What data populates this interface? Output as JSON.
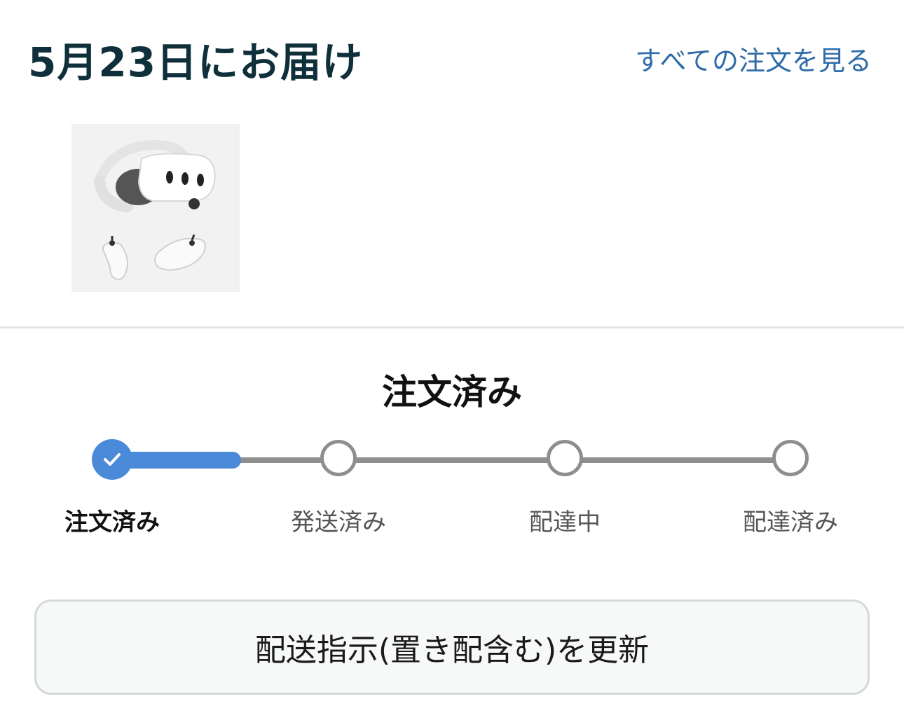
{
  "header": {
    "title": "5月23日にお届け",
    "view_all_link": "すべての注文を見る"
  },
  "product": {
    "image_icon": "vr-headset-with-controllers-image"
  },
  "status": {
    "title": "注文済み",
    "current_step": 0,
    "steps": [
      {
        "label": "注文済み",
        "state": "done"
      },
      {
        "label": "発送済み",
        "state": "pending"
      },
      {
        "label": "配達中",
        "state": "pending"
      },
      {
        "label": "配達済み",
        "state": "pending"
      }
    ]
  },
  "actions": {
    "update_button": "配送指示(置き配含む)を更新"
  },
  "colors": {
    "accent": "#4a8ad8",
    "link": "#2f6ba8",
    "title": "#0f2f3a",
    "track_gray": "#8e8e8e"
  }
}
